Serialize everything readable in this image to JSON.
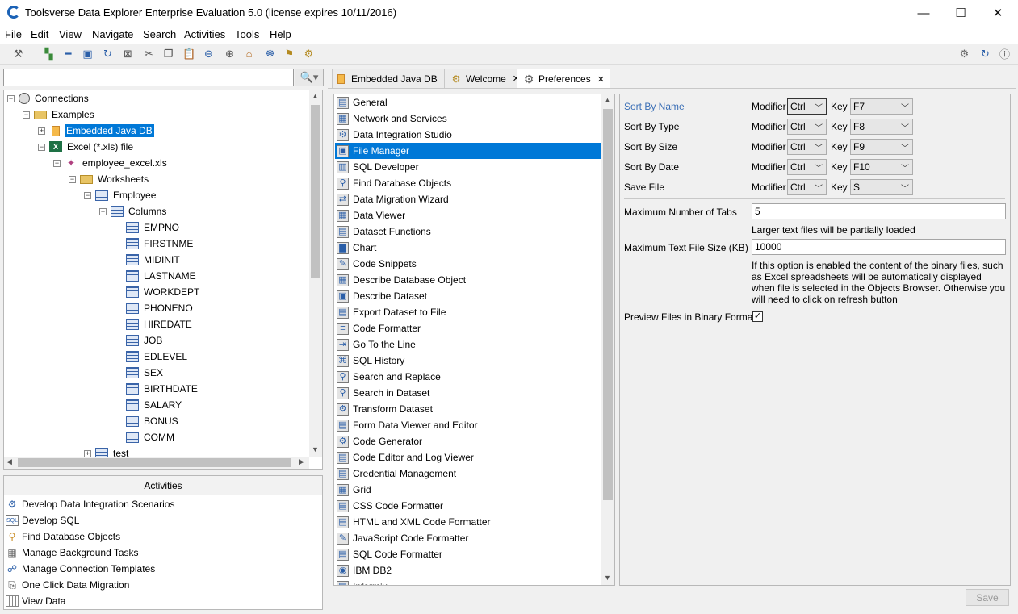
{
  "window": {
    "title": "Toolsverse Data Explorer Enterprise Evaluation 5.0 (license expires 10/11/2016)",
    "minimize": "—",
    "maximize": "☐",
    "close": "✕"
  },
  "menu": [
    "File",
    "Edit",
    "View",
    "Navigate",
    "Search",
    "Activities",
    "Tools",
    "Help"
  ],
  "search": {
    "value": "",
    "button_icon": "🔍▾"
  },
  "tree": [
    {
      "label": "Connections",
      "level": 0,
      "toggle": "−",
      "icon": "globe"
    },
    {
      "label": "Examples",
      "level": 1,
      "toggle": "−",
      "icon": "folder"
    },
    {
      "label": "Embedded Java DB",
      "level": 2,
      "toggle": "+",
      "icon": "db",
      "selected": true
    },
    {
      "label": "Excel (*.xls) file",
      "level": 2,
      "toggle": "−",
      "icon": "xls"
    },
    {
      "label": "employee_excel.xls",
      "level": 3,
      "toggle": "−",
      "icon": "diamond"
    },
    {
      "label": "Worksheets",
      "level": 4,
      "toggle": "−",
      "icon": "folder-table"
    },
    {
      "label": "Employee",
      "level": 5,
      "toggle": "−",
      "icon": "table"
    },
    {
      "label": "Columns",
      "level": 6,
      "toggle": "−",
      "icon": "table"
    },
    {
      "label": "EMPNO",
      "level": 7,
      "icon": "table"
    },
    {
      "label": "FIRSTNME",
      "level": 7,
      "icon": "table"
    },
    {
      "label": "MIDINIT",
      "level": 7,
      "icon": "table"
    },
    {
      "label": "LASTNAME",
      "level": 7,
      "icon": "table"
    },
    {
      "label": "WORKDEPT",
      "level": 7,
      "icon": "table"
    },
    {
      "label": "PHONENO",
      "level": 7,
      "icon": "table"
    },
    {
      "label": "HIREDATE",
      "level": 7,
      "icon": "table"
    },
    {
      "label": "JOB",
      "level": 7,
      "icon": "table"
    },
    {
      "label": "EDLEVEL",
      "level": 7,
      "icon": "table"
    },
    {
      "label": "SEX",
      "level": 7,
      "icon": "table"
    },
    {
      "label": "BIRTHDATE",
      "level": 7,
      "icon": "table"
    },
    {
      "label": "SALARY",
      "level": 7,
      "icon": "table"
    },
    {
      "label": "BONUS",
      "level": 7,
      "icon": "table"
    },
    {
      "label": "COMM",
      "level": 7,
      "icon": "table"
    },
    {
      "label": "test",
      "level": 5,
      "toggle": "+",
      "icon": "table"
    }
  ],
  "activities": {
    "header": "Activities",
    "items": [
      "Develop Data Integration Scenarios",
      "Develop SQL",
      "Find Database Objects",
      "Manage Background Tasks",
      "Manage Connection Templates",
      "One Click Data Migration",
      "View Data"
    ]
  },
  "tabs": [
    {
      "label": "Embedded Java DB",
      "close": "✕",
      "active": false
    },
    {
      "label": "Welcome",
      "close": "✕",
      "active": false
    },
    {
      "label": "Preferences",
      "close": "✕",
      "active": true
    }
  ],
  "preferences": {
    "selected": "File Manager",
    "items": [
      "General",
      "Network and Services",
      "Data Integration Studio",
      "File Manager",
      "SQL Developer",
      "Find Database Objects",
      "Data Migration Wizard",
      "Data Viewer",
      "Dataset Functions",
      "Chart",
      "Code Snippets",
      "Describe Database Object",
      "Describe Dataset",
      "Export Dataset to File",
      "Code Formatter",
      "Go To the Line",
      "SQL History",
      "Search and Replace",
      "Search in Dataset",
      "Transform Dataset",
      "Form Data Viewer and Editor",
      "Code Generator",
      "Code Editor and Log Viewer",
      "Credential Management",
      "Grid",
      "CSS Code Formatter",
      "HTML and XML Code Formatter",
      "JavaScript Code Formatter",
      "SQL Code Formatter",
      "IBM DB2",
      "Informix"
    ]
  },
  "settings": {
    "shortcuts": [
      {
        "label": "Sort By Name",
        "modifier": "Ctrl",
        "key": "F7",
        "highlight": true
      },
      {
        "label": "Sort By Type",
        "modifier": "Ctrl",
        "key": "F8"
      },
      {
        "label": "Sort By Size",
        "modifier": "Ctrl",
        "key": "F9"
      },
      {
        "label": "Sort By Date",
        "modifier": "Ctrl",
        "key": "F10"
      },
      {
        "label": "Save File",
        "modifier": "Ctrl",
        "key": "S"
      }
    ],
    "modifier_label": "Modifier",
    "key_label": "Key",
    "max_tabs_label": "Maximum Number of Tabs",
    "max_tabs_value": "5",
    "larger_files_note": "Larger text files will be partially loaded",
    "max_file_size_label": "Maximum Text File Size (KB)",
    "max_file_size_value": "10000",
    "binary_note": "If this option is enabled the content of the binary files, such as Excel spreadsheets will be automatically displayed when file is selected in the Objects Browser. Otherwise you will need to click on refresh button",
    "preview_label": "Preview Files in Binary Formats",
    "preview_checked": true,
    "save_label": "Save"
  },
  "colors": {
    "selection": "#0078d7",
    "link_label": "#3b6fb6"
  }
}
